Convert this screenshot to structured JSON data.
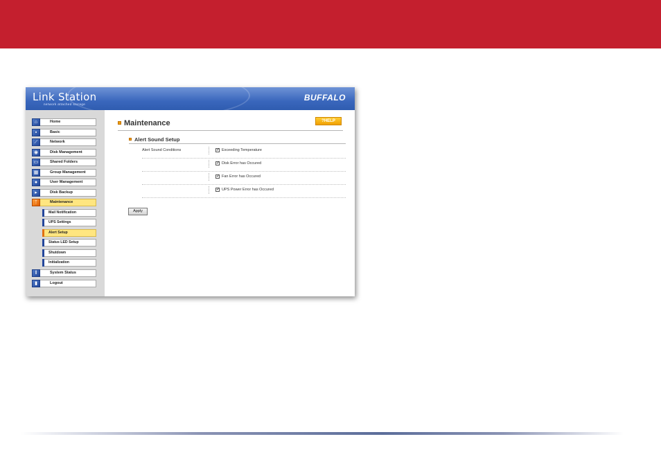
{
  "colors": {
    "top_band": "#c41f2e",
    "banner": "#3a67bd",
    "active_highlight": "#ffe680",
    "help_button": "#f0a000"
  },
  "header": {
    "product_name": "Link Station",
    "product_subtitle": "network attached storage",
    "brand": "BUFFALO"
  },
  "sidebar": {
    "items": [
      {
        "label": "Home",
        "icon": "home-icon"
      },
      {
        "label": "Basic",
        "icon": "basic-settings-icon"
      },
      {
        "label": "Network",
        "icon": "network-icon"
      },
      {
        "label": "Disk Management",
        "icon": "disk-icon"
      },
      {
        "label": "Shared Folders",
        "icon": "folder-icon"
      },
      {
        "label": "Group Management",
        "icon": "group-icon"
      },
      {
        "label": "User Management",
        "icon": "user-icon"
      },
      {
        "label": "Disk Backup",
        "icon": "backup-icon"
      },
      {
        "label": "Maintenance",
        "icon": "wrench-icon",
        "active": true
      }
    ],
    "subitems": [
      {
        "label": "Mail Notification"
      },
      {
        "label": "UPS Settings"
      },
      {
        "label": "Alert Setup",
        "active": true
      },
      {
        "label": "Status LED Setup"
      },
      {
        "label": "Shutdown"
      },
      {
        "label": "Initialization"
      }
    ],
    "bottom_items": [
      {
        "label": "System Status",
        "icon": "status-icon"
      },
      {
        "label": "Logout",
        "icon": "logout-icon"
      }
    ]
  },
  "main": {
    "title": "Maintenance",
    "help_label": "?HELP",
    "section_title": "Alert Sound Setup",
    "field_label": "Alert Sound Conditions",
    "options": [
      {
        "label": "Exceeding Temperature",
        "checked": true
      },
      {
        "label": "Disk Error has Occured",
        "checked": true
      },
      {
        "label": "Fan Error has Occured",
        "checked": true
      },
      {
        "label": "UPS Power Error has Occured",
        "checked": true
      }
    ],
    "apply_label": "Apply"
  }
}
